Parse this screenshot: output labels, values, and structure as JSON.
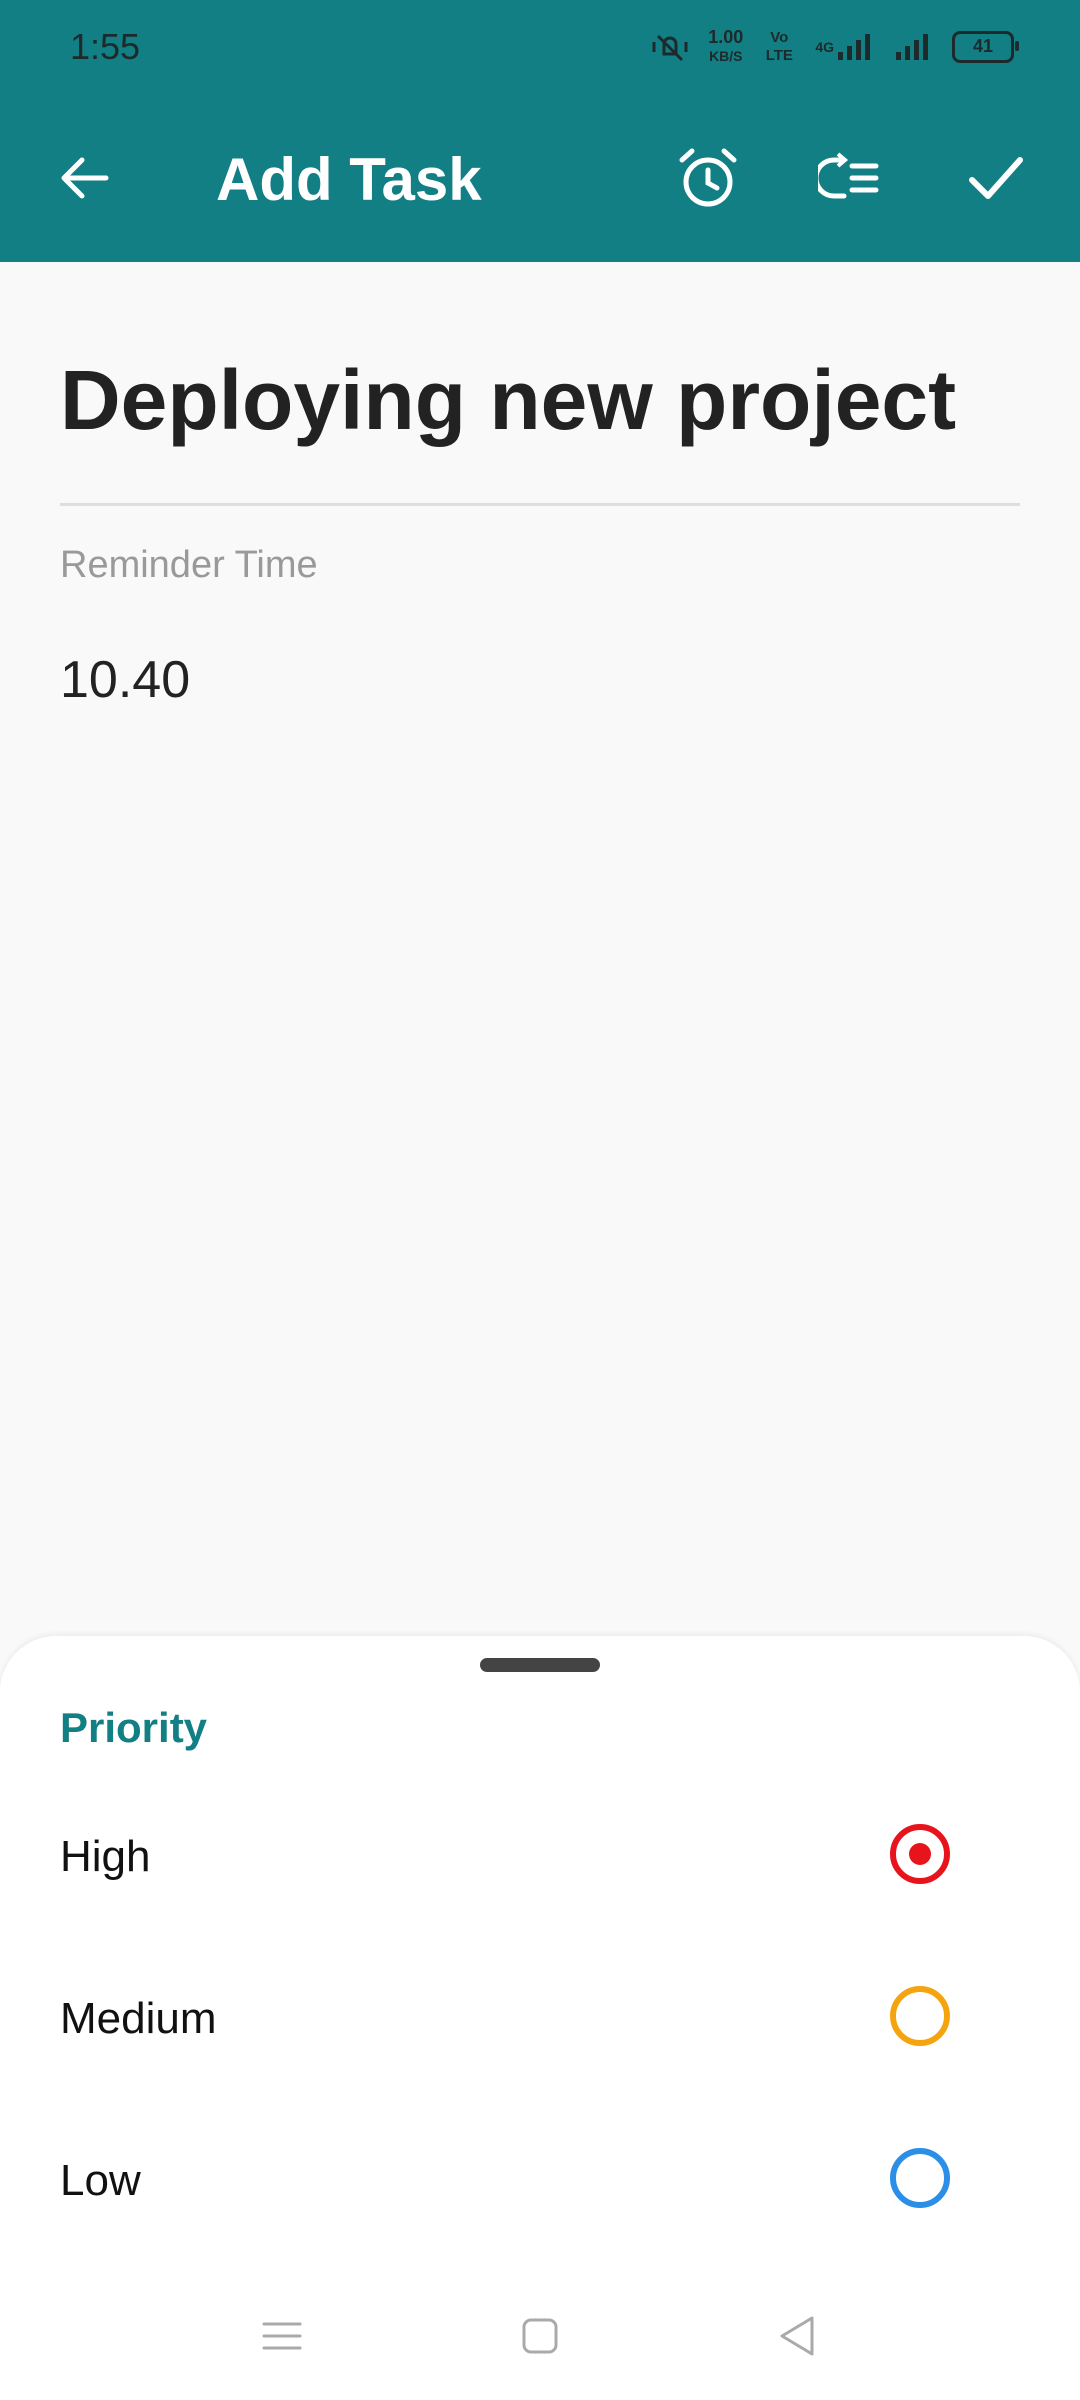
{
  "status_bar": {
    "time": "1:55",
    "net_speed": "1.00",
    "net_speed_unit": "KB/S",
    "volte_label": "Vo LTE",
    "network_label": "4G",
    "battery": "41"
  },
  "app_bar": {
    "title": "Add Task",
    "background": "#127f84",
    "icons": [
      "back-arrow-icon",
      "alarm-clock-icon",
      "repeat-list-icon",
      "checkmark-icon"
    ]
  },
  "task": {
    "title": "Deploying new project",
    "reminder_label": "Reminder Time",
    "reminder_value": "10.40"
  },
  "priority_sheet": {
    "title": "Priority",
    "options": [
      {
        "label": "High",
        "color": "#e8141c",
        "selected": true
      },
      {
        "label": "Medium",
        "color": "#f5a30e",
        "selected": false
      },
      {
        "label": "Low",
        "color": "#2b8fe8",
        "selected": false
      }
    ]
  },
  "nav_bar": {
    "icons": [
      "menu-icon",
      "home-square-icon",
      "back-triangle-icon"
    ]
  }
}
